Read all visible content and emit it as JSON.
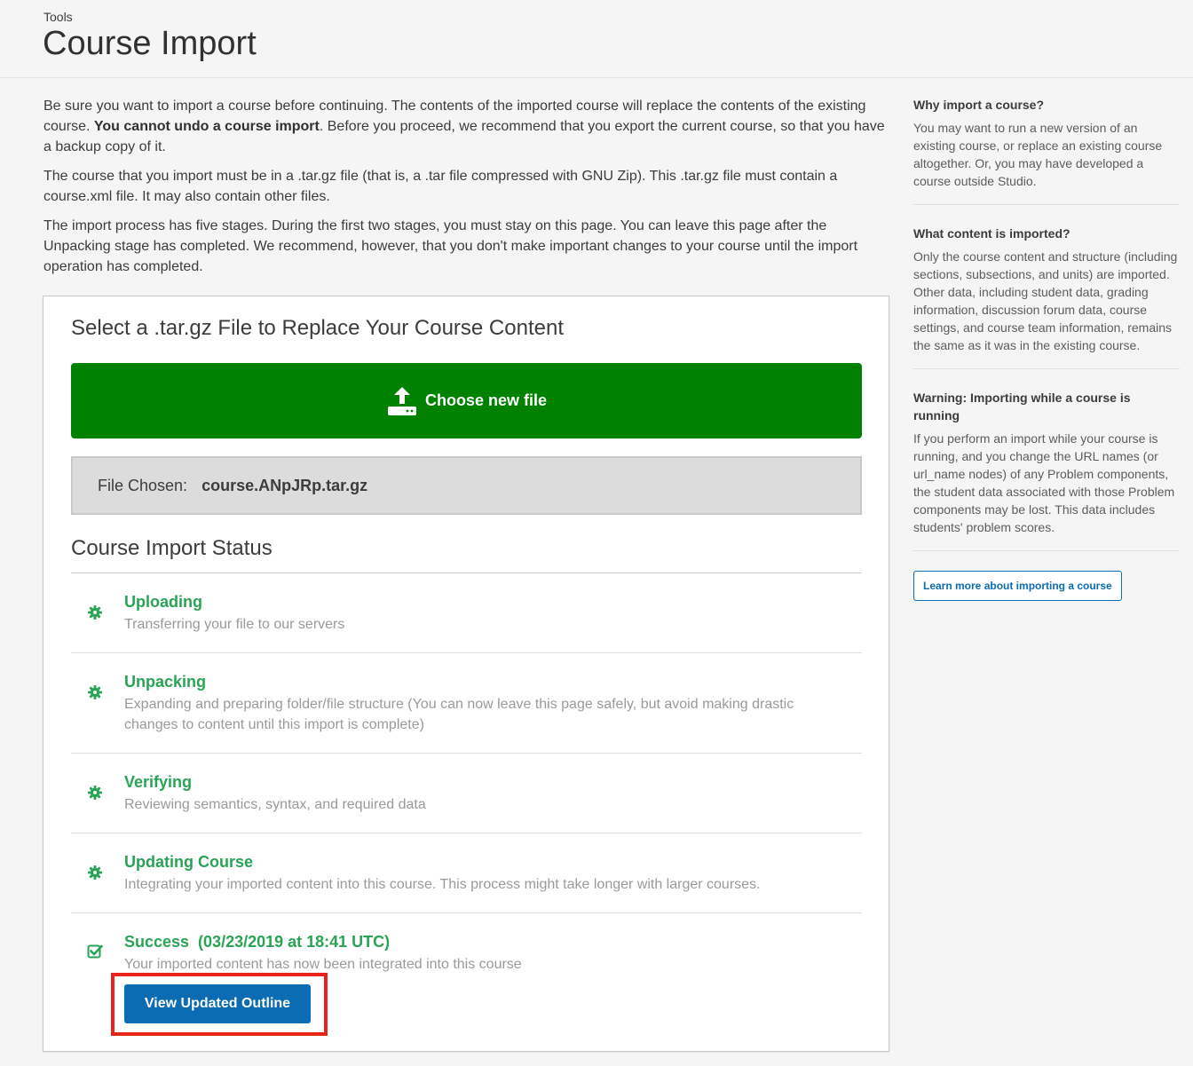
{
  "header": {
    "breadcrumb": "Tools",
    "title": "Course Import"
  },
  "intro": {
    "p1_a": "Be sure you want to import a course before continuing. The contents of the imported course will replace the contents of the existing course. ",
    "p1_bold": "You cannot undo a course import",
    "p1_b": ". Before you proceed, we recommend that you export the current course, so that you have a backup copy of it.",
    "p2": "The course that you import must be in a .tar.gz file (that is, a .tar file compressed with GNU Zip). This .tar.gz file must contain a course.xml file. It may also contain other files.",
    "p3": "The import process has five stages. During the first two stages, you must stay on this page. You can leave this page after the Unpacking stage has completed. We recommend, however, that you don't make important changes to your course until the import operation has completed."
  },
  "upload": {
    "title": "Select a .tar.gz File to Replace Your Course Content",
    "choose_label": "Choose new file",
    "file_chosen_label": "File Chosen:",
    "file_name": "course.ANpJRp.tar.gz"
  },
  "status": {
    "title": "Course Import Status",
    "stages": [
      {
        "label": "Uploading",
        "desc": "Transferring your file to our servers",
        "icon": "gear-icon"
      },
      {
        "label": "Unpacking",
        "desc": "Expanding and preparing folder/file structure (You can now leave this page safely, but avoid making drastic changes to content until this import is complete)",
        "icon": "gear-icon"
      },
      {
        "label": "Verifying",
        "desc": "Reviewing semantics, syntax, and required data",
        "icon": "gear-icon"
      },
      {
        "label": "Updating Course",
        "desc": "Integrating your imported content into this course. This process might take longer with larger courses.",
        "icon": "gear-icon"
      },
      {
        "label": "Success  (03/23/2019 at 18:41 UTC)",
        "desc": "Your imported content has now been integrated into this course",
        "icon": "check-square-icon"
      }
    ],
    "view_button": "View Updated Outline"
  },
  "sidebar": {
    "why_title": "Why import a course?",
    "why_text": "You may want to run a new version of an existing course, or replace an existing course altogether. Or, you may have developed a course outside Studio.",
    "what_title": "What content is imported?",
    "what_text": "Only the course content and structure (including sections, subsections, and units) are imported. Other data, including student data, grading information, discussion forum data, course settings, and course team information, remains the same as it was in the existing course.",
    "warn_title": "Warning: Importing while a course is running",
    "warn_text": "If you perform an import while your course is running, and you change the URL names (or url_name nodes) of any Problem components, the student data associated with those Problem components may be lost. This data includes students' problem scores.",
    "learn_button": "Learn more about importing a course"
  },
  "colors": {
    "success_green": "#29a354",
    "choose_button": "#008100",
    "primary_blue": "#0b6cb4",
    "highlight_red": "#e8241a"
  }
}
